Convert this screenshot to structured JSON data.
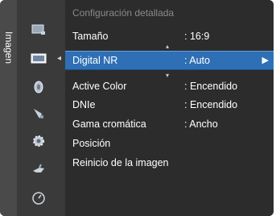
{
  "side_tab": {
    "label": "Imagen"
  },
  "header": "Configuración detallada",
  "icons": [
    "tv-screen-icon",
    "picture-icon",
    "sound-icon",
    "channel-icon",
    "settings-gear-icon",
    "input-plug-icon",
    "support-icon"
  ],
  "menu": [
    {
      "label": "Tamaño",
      "value": ": 16:9"
    },
    {
      "label": "Digital NR",
      "value": ": Auto",
      "selected": true
    },
    {
      "label": "Active Color",
      "value": ": Encendido"
    },
    {
      "label": "DNIe",
      "value": ": Encendido"
    },
    {
      "label": "Gama cromática",
      "value": ": Ancho"
    },
    {
      "label": "Posición",
      "value": ""
    },
    {
      "label": "Reinicio de la imagen",
      "value": ""
    }
  ],
  "glyphs": {
    "left": "◂",
    "right": "▶",
    "up": "▴",
    "down": "▾"
  }
}
